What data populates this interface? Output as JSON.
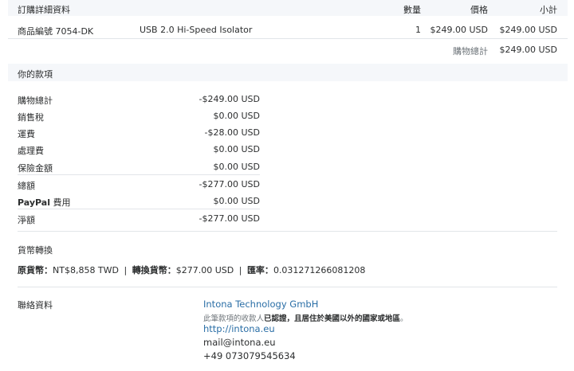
{
  "order": {
    "header": {
      "title": "訂購詳細資料",
      "qty": "數量",
      "price": "價格",
      "subtotal": "小計"
    },
    "item": {
      "number": "商品編號 7054-DK",
      "name": "USB 2.0 Hi-Speed Isolator",
      "qty": "1",
      "price": "$249.00 USD",
      "subtotal": "$249.00 USD"
    },
    "total": {
      "label": "購物總計",
      "value": "$249.00 USD"
    }
  },
  "payment": {
    "title": "你的款項",
    "rows": [
      {
        "label": "購物總計",
        "value": "-$249.00 USD"
      },
      {
        "label": "銷售稅",
        "value": "$0.00 USD"
      },
      {
        "label": "運費",
        "value": "-$28.00 USD"
      },
      {
        "label": "處理費",
        "value": "$0.00 USD"
      },
      {
        "label": "保險金額",
        "value": "$0.00 USD"
      },
      {
        "label": "總額",
        "value": "-$277.00 USD"
      },
      {
        "label_brand": "PayPal",
        "label": "費用",
        "value": "$0.00 USD"
      },
      {
        "label": "淨額",
        "value": "-$277.00 USD"
      }
    ]
  },
  "currency": {
    "title": "貨幣轉換",
    "original_label": "原貨幣：",
    "original_value": "NT$8,858 TWD",
    "converted_label": "轉換貨幣：",
    "converted_value": "$277.00 USD",
    "rate_label": "匯率：",
    "rate_value": "0.031271266081208",
    "separator": "|"
  },
  "contact": {
    "title": "聯絡資料",
    "company": "Intona Technology GmbH",
    "note_prefix": "此筆款項的收款人",
    "note_bold": "已認證，且居住於美國以外的國家或地區",
    "note_suffix": "。",
    "website": "http://intona.eu",
    "email": "mail@intona.eu",
    "phone": "+49 073079545634"
  }
}
